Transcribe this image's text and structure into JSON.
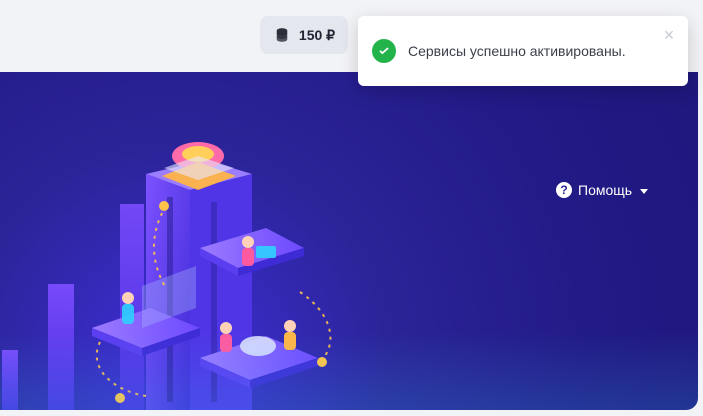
{
  "header": {
    "balance_text": "150 ₽"
  },
  "toast": {
    "message": "Сервисы успешно активированы.",
    "close_icon": "×"
  },
  "banner": {
    "help_label": "Помощь"
  },
  "colors": {
    "banner_base": "#221a86",
    "banner_accent": "#3f2ed8",
    "success_green": "#22b34a",
    "pill_bg": "#e4e7ee"
  },
  "icons": {
    "balance": "coins-icon",
    "success": "check-circle-icon",
    "help": "help-icon",
    "dropdown": "chevron-down-icon",
    "close": "close-icon"
  }
}
